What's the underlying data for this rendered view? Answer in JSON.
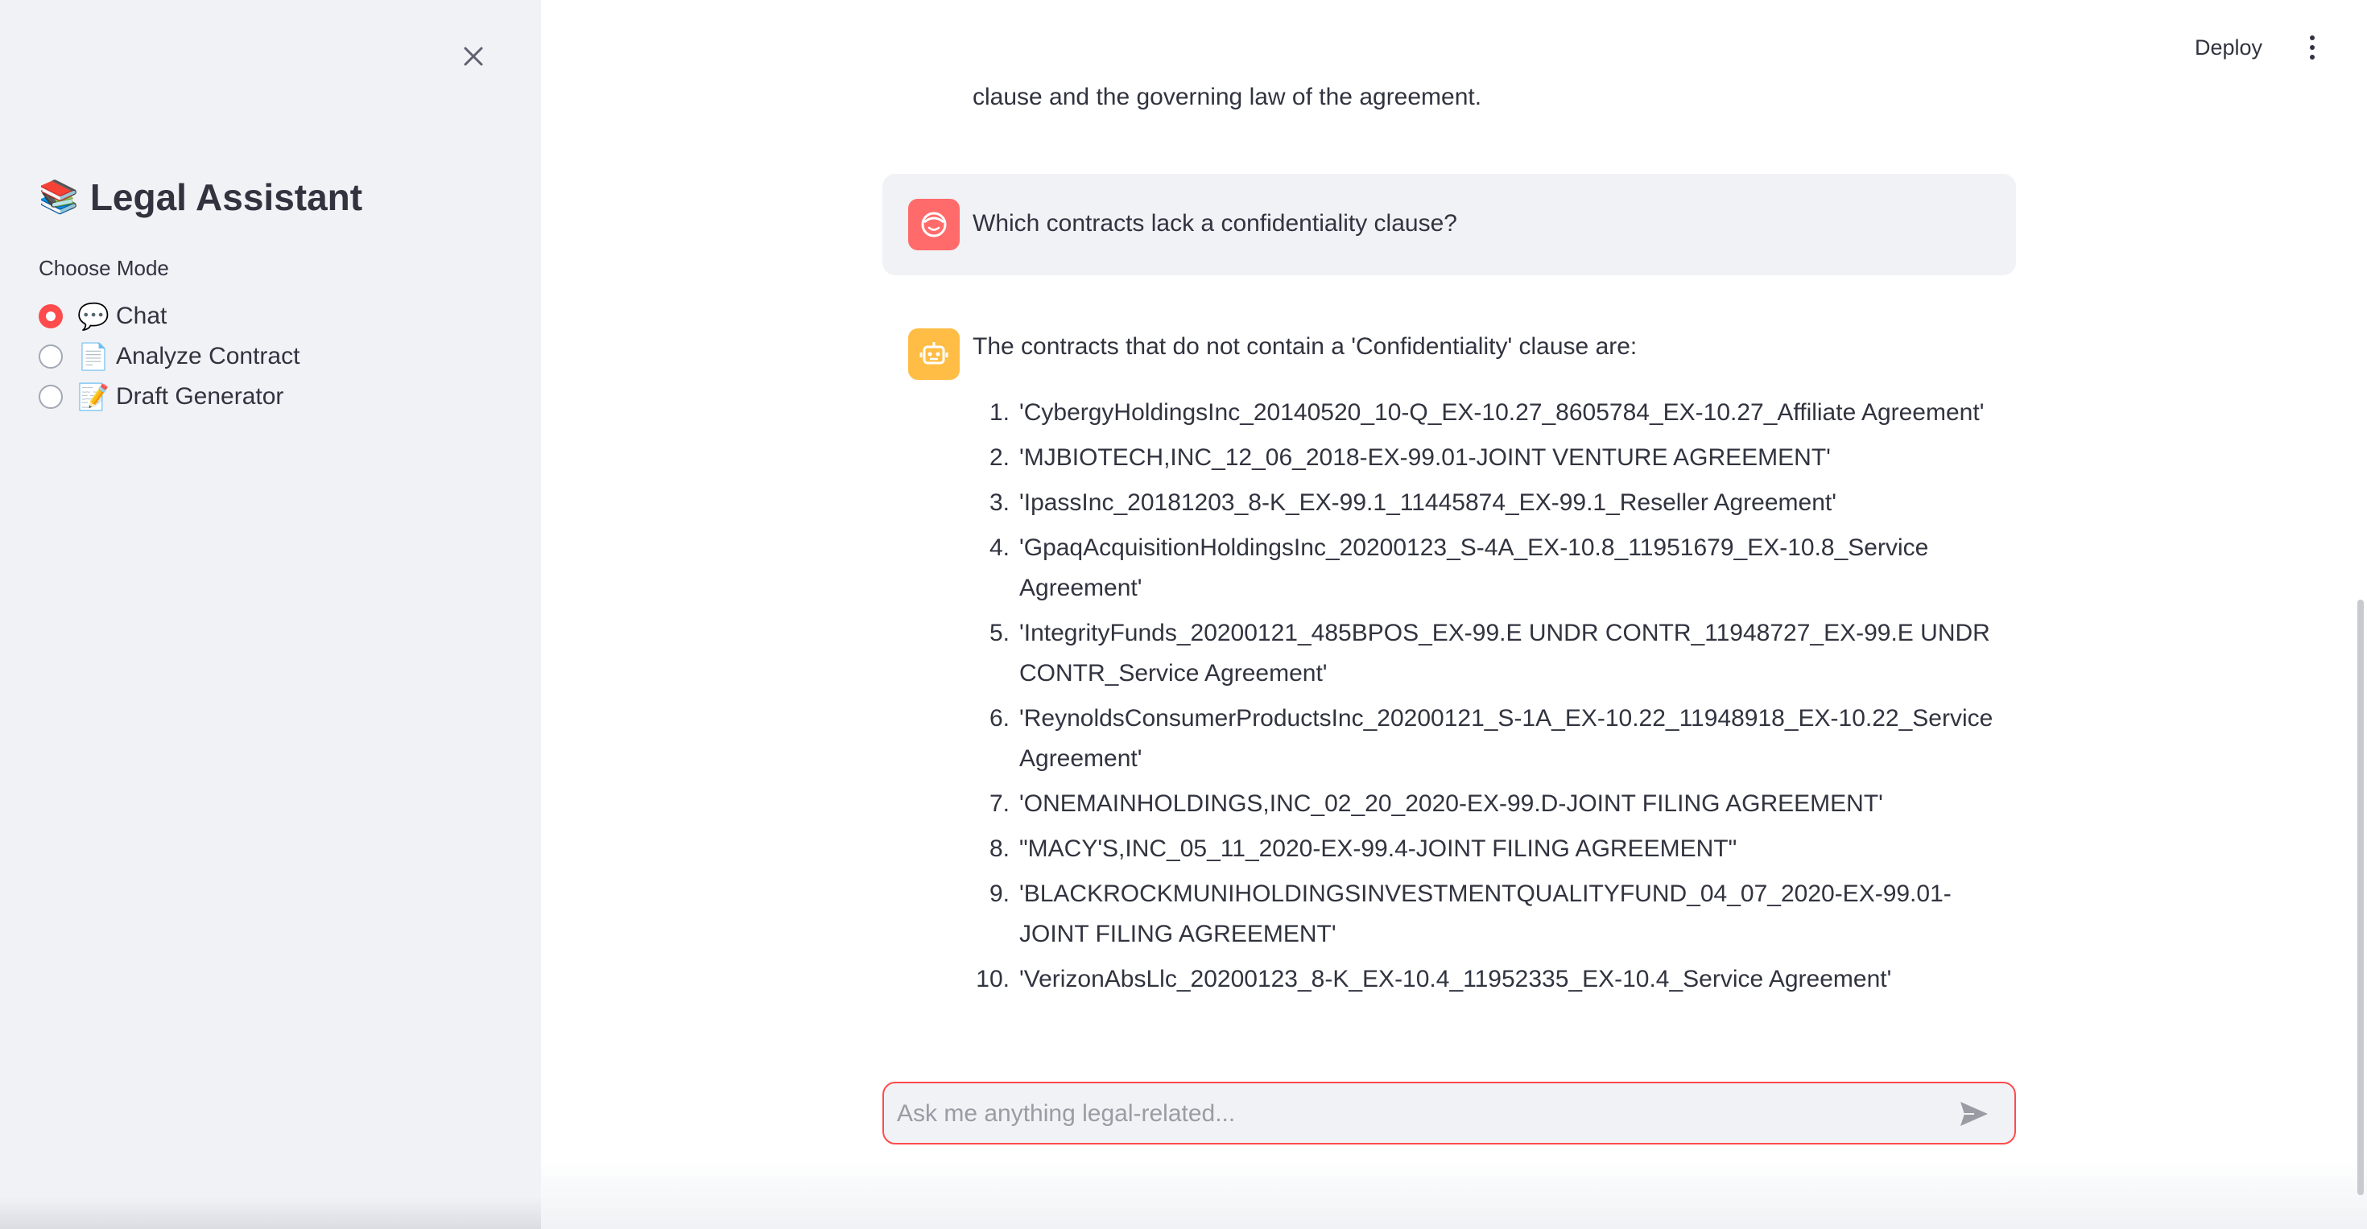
{
  "sidebar": {
    "title": "Legal Assistant",
    "title_emoji": "📚",
    "mode_label": "Choose Mode",
    "modes": [
      {
        "emoji": "💬",
        "label": "Chat",
        "selected": true
      },
      {
        "emoji": "📄",
        "label": "Analyze Contract",
        "selected": false
      },
      {
        "emoji": "📝",
        "label": "Draft Generator",
        "selected": false
      }
    ]
  },
  "header": {
    "deploy_label": "Deploy"
  },
  "chat": {
    "prev_text": "clause and the governing law of the agreement.",
    "user_message": "Which contracts lack a confidentiality clause?",
    "assistant_intro": "The contracts that do not contain a 'Confidentiality' clause are:",
    "items": [
      {
        "num": "1.",
        "text": "'CybergyHoldingsInc_20140520_10-Q_EX-10.27_8605784_EX-10.27_Affiliate Agreement'"
      },
      {
        "num": "2.",
        "text": "'MJBIOTECH,INC_12_06_2018-EX-99.01-JOINT VENTURE AGREEMENT'"
      },
      {
        "num": "3.",
        "text": "'IpassInc_20181203_8-K_EX-99.1_11445874_EX-99.1_Reseller Agreement'"
      },
      {
        "num": "4.",
        "text": "'GpaqAcquisitionHoldingsInc_20200123_S-4A_EX-10.8_11951679_EX-10.8_Service Agreement'"
      },
      {
        "num": "5.",
        "text": "'IntegrityFunds_20200121_485BPOS_EX-99.E UNDR CONTR_11948727_EX-99.E UNDR CONTR_Service Agreement'"
      },
      {
        "num": "6.",
        "text": "'ReynoldsConsumerProductsInc_20200121_S-1A_EX-10.22_11948918_EX-10.22_Service Agreement'"
      },
      {
        "num": "7.",
        "text": "'ONEMAINHOLDINGS,INC_02_20_2020-EX-99.D-JOINT FILING AGREEMENT'"
      },
      {
        "num": "8.",
        "text": "\"MACY'S,INC_05_11_2020-EX-99.4-JOINT FILING AGREEMENT\""
      },
      {
        "num": "9.",
        "text": "'BLACKROCKMUNIHOLDINGSINVESTMENTQUALITYFUND_04_07_2020-EX-99.01-JOINT FILING AGREEMENT'"
      },
      {
        "num": "10.",
        "text": "'VerizonAbsLlc_20200123_8-K_EX-10.4_11952335_EX-10.4_Service Agreement'"
      }
    ]
  },
  "input": {
    "placeholder": "Ask me anything legal-related...",
    "value": ""
  },
  "colors": {
    "accent": "#ff4b4b",
    "sidebar_bg": "#f0f2f6",
    "user_avatar": "#ff6b6b",
    "bot_avatar": "#ffbd45"
  }
}
